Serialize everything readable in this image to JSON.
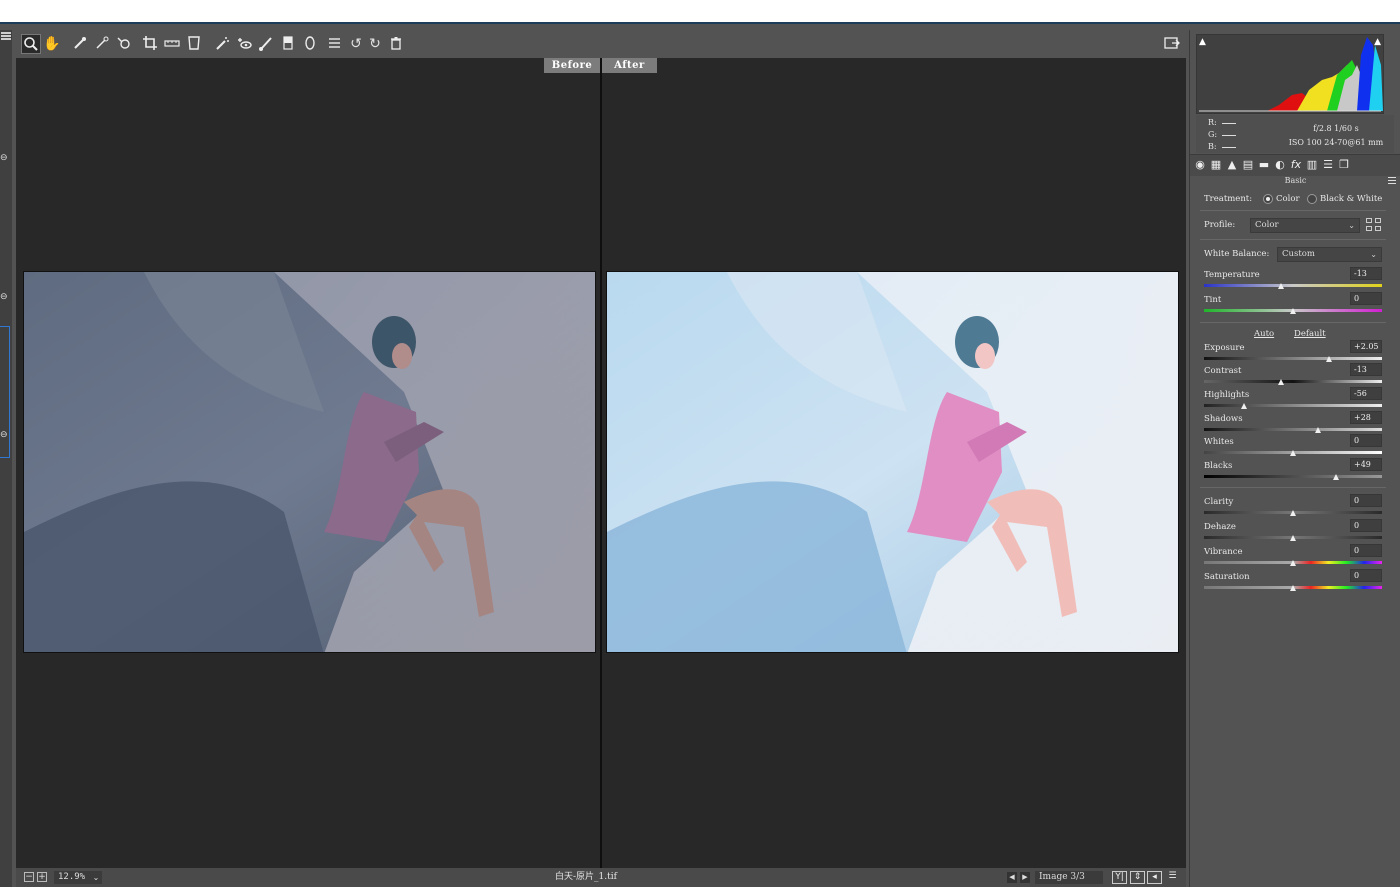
{
  "preview": {
    "before_label": "Before",
    "after_label": "After"
  },
  "status": {
    "zoom": "12.9%",
    "filename": "白天-原片_1.tif",
    "image_count": "Image 3/3"
  },
  "info": {
    "r_label": "R:",
    "g_label": "G:",
    "b_label": "B:",
    "exif_line1": "f/2.8   1/60 s",
    "exif_line2": "ISO 100   24-70@61 mm"
  },
  "basic": {
    "section_title": "Basic",
    "treatment_label": "Treatment:",
    "treatment_options": [
      "Color",
      "Black & White"
    ],
    "treatment_selected": "Color",
    "profile_label": "Profile:",
    "profile_value": "Color",
    "wb_label": "White Balance:",
    "wb_value": "Custom",
    "auto_label": "Auto",
    "default_label": "Default",
    "sliders": [
      {
        "label": "Temperature",
        "value": "-13"
      },
      {
        "label": "Tint",
        "value": "0"
      },
      {
        "label": "Exposure",
        "value": "+2.05"
      },
      {
        "label": "Contrast",
        "value": "-13"
      },
      {
        "label": "Highlights",
        "value": "-56"
      },
      {
        "label": "Shadows",
        "value": "+28"
      },
      {
        "label": "Whites",
        "value": "0"
      },
      {
        "label": "Blacks",
        "value": "+49"
      },
      {
        "label": "Clarity",
        "value": "0"
      },
      {
        "label": "Dehaze",
        "value": "0"
      },
      {
        "label": "Vibrance",
        "value": "0"
      },
      {
        "label": "Saturation",
        "value": "0"
      }
    ]
  },
  "colors": {
    "panel_bg": "#535353",
    "viewer_bg": "#282828"
  }
}
